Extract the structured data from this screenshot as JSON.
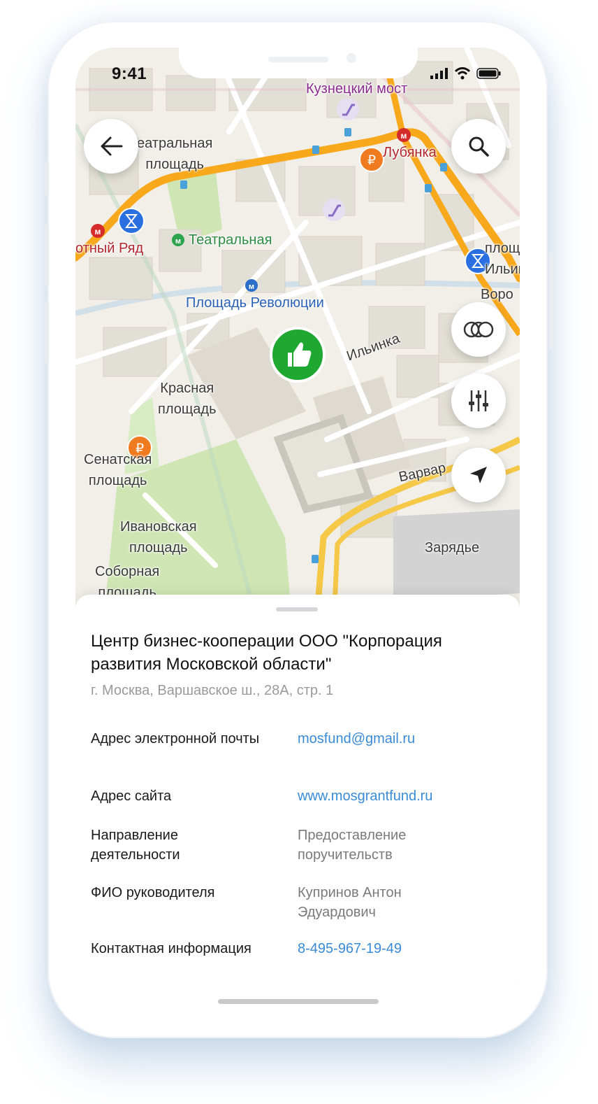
{
  "status_bar": {
    "time": "9:41"
  },
  "map": {
    "labels": {
      "kuznetsky_most": "Кузнецкий мост",
      "teatralnaya_ploshad": "еатральная\nплощадь",
      "lubyanka": "Лубянка",
      "okhotny_ryad": "отный Ряд",
      "teatralnaya_metro": "Театральная",
      "ploshad_revolyutsii": "Площадь Революции",
      "ploshad_ilyinskie": "площа\nИльинс",
      "vorota": "Воро",
      "krasnaya_ploshad": "Красная\nплощадь",
      "ilyinka": "Ильинка",
      "senatskaya": "Сенатская\nплощадь",
      "varvarka": "Варвар",
      "ivanovskaya": "Ивановская\nплощадь",
      "zaryadye": "Зарядье",
      "sobornaya": "Соборная\nплощадь"
    },
    "route_color": "#f7a81b",
    "marker_color": "#1ea831"
  },
  "controls": {
    "back_icon": "arrow-left-icon",
    "search_icon": "search-icon",
    "layers_icon": "layers-icon",
    "filters_icon": "sliders-icon",
    "location_icon": "navigation-arrow-icon"
  },
  "sheet": {
    "title": "Центр бизнес-кооперации  ООО \"Корпорация развития Московской области\"",
    "address": "г. Москва, Варшавское ш., 28А, стр. 1",
    "rows": [
      {
        "label": "Адрес электронной почты",
        "value": "mosfund@gmail.ru",
        "link": true
      },
      {
        "label": "Адрес сайта",
        "value": "www.mosgrantfund.ru",
        "link": true
      },
      {
        "label": "Направление деятельности",
        "value": "Предоставление поручительств",
        "link": false
      },
      {
        "label": "ФИО руководителя",
        "value": "Купринов Антон Эдуардович",
        "link": false
      },
      {
        "label": "Контактная информация",
        "value": "8-495-967-19-49",
        "link": true
      }
    ],
    "link_color": "#3a8bd6"
  }
}
